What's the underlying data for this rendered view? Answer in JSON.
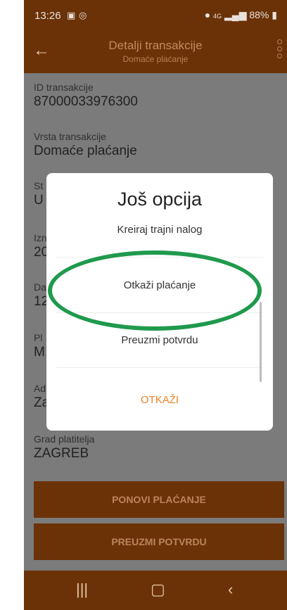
{
  "status_bar": {
    "time": "13:26",
    "battery": "88%",
    "network": "4G"
  },
  "header": {
    "title": "Detalji transakcije",
    "subtitle": "Domaće plaćanje"
  },
  "fields": [
    {
      "label": "ID transakcije",
      "value": "87000033976300"
    },
    {
      "label": "Vrsta transakcije",
      "value": "Domaće plaćanje"
    },
    {
      "label": "St",
      "value": "U"
    },
    {
      "label": "Izn",
      "value": "20"
    },
    {
      "label": "Da",
      "value": "12"
    },
    {
      "label": "Pl",
      "value": "M"
    },
    {
      "label": "Ad",
      "value": "Za"
    },
    {
      "label": "Grad platitelja",
      "value": "ZAGREB"
    }
  ],
  "buttons": {
    "repeat_payment": "PONOVI PLAĆANJE",
    "download_confirmation": "PREUZMI POTVRDU"
  },
  "dialog": {
    "title": "Još opcija",
    "options": [
      "Kreiraj trajni nalog",
      "Otkaži plaćanje",
      "Preuzmi potvrdu"
    ],
    "cancel": "OTKAŽI"
  },
  "colors": {
    "brand_dark": "#6b3208",
    "accent_orange": "#e8822a",
    "highlight_green": "#1f9a4d"
  },
  "icons": {
    "back": "arrow-left-icon",
    "more": "more-vert-icon",
    "nav_recent": "recent-apps-icon",
    "nav_home": "home-icon",
    "nav_back": "back-icon"
  }
}
